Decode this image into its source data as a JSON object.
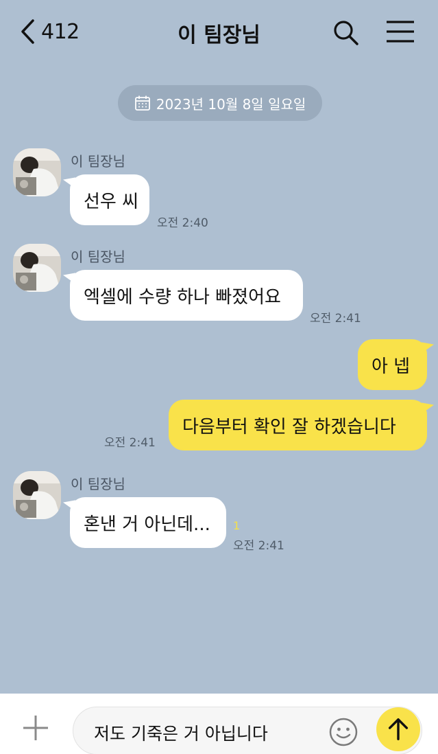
{
  "header": {
    "back_count": "412",
    "title": "이 팀장님"
  },
  "date_divider": "2023년 10월 8일 일요일",
  "messages": [
    {
      "sender": "이 팀장님",
      "text": "선우 씨",
      "time": "오전 2:40"
    },
    {
      "sender": "이 팀장님",
      "text": "엑셀에 수량 하나 빠졌어요",
      "time": "오전 2:41"
    },
    {
      "text": "아 넵"
    },
    {
      "text": "다음부터 확인 잘 하겠습니다",
      "time": "오전 2:41"
    },
    {
      "sender": "이 팀장님",
      "text": "혼낸 거 아닌데...",
      "time": "오전 2:41",
      "unread": "1"
    }
  ],
  "composer": {
    "value": "저도 기죽은 거 아닙니다"
  },
  "colors": {
    "background": "#aebfd1",
    "outgoing_bubble": "#f9e24a",
    "incoming_bubble": "#ffffff",
    "send_button": "#f9e24a"
  },
  "icons": [
    "back-chevron-icon",
    "search-icon",
    "menu-icon",
    "calendar-icon",
    "plus-icon",
    "emoji-icon",
    "send-arrow-icon"
  ]
}
